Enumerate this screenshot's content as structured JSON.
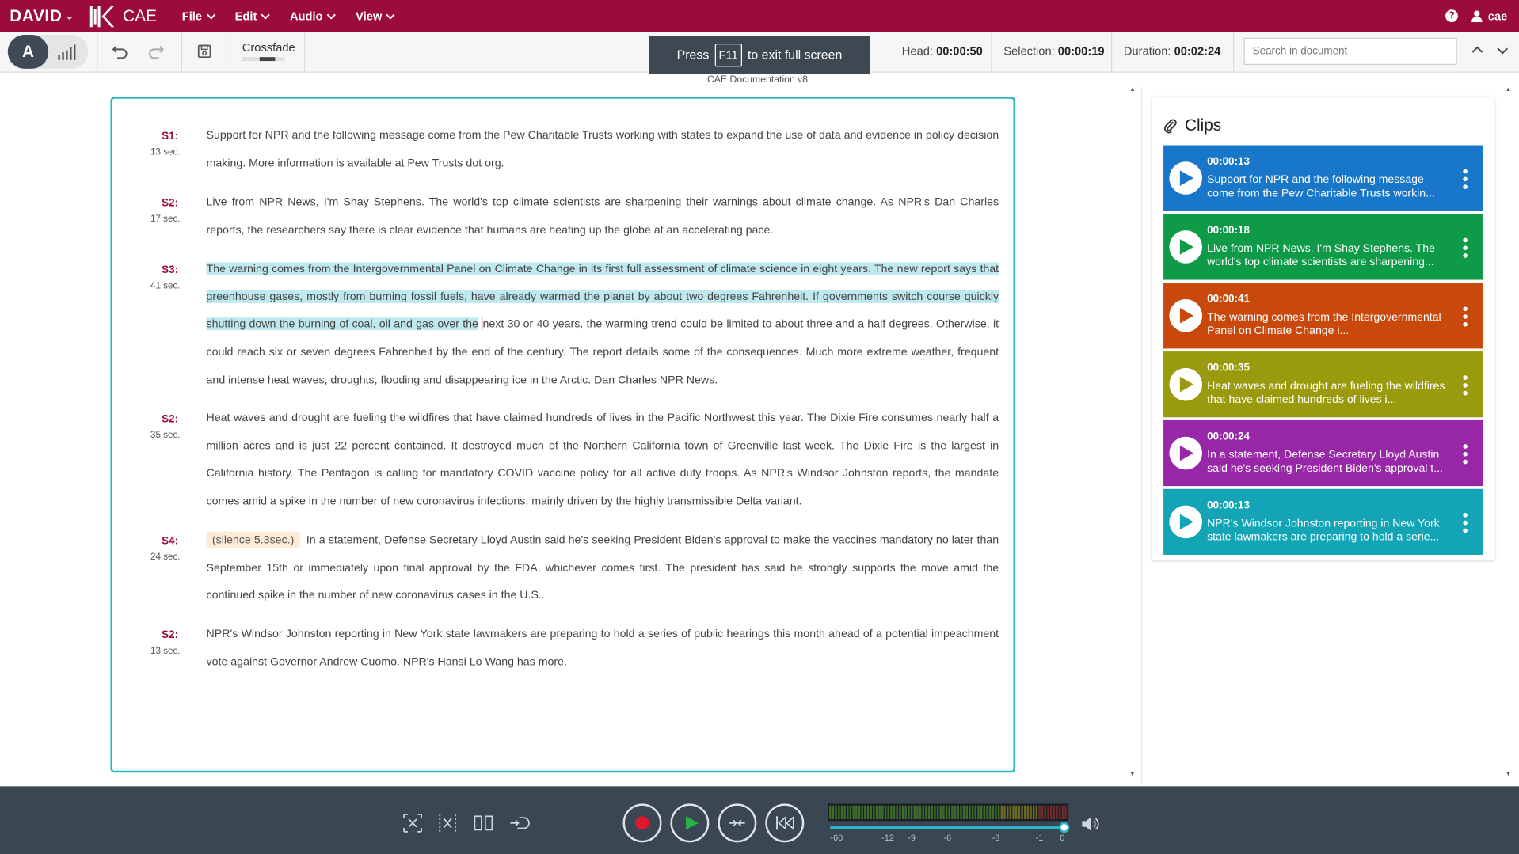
{
  "app": {
    "brand": "DAVID",
    "name": "CAE"
  },
  "menu": [
    {
      "label": "File"
    },
    {
      "label": "Edit"
    },
    {
      "label": "Audio"
    },
    {
      "label": "View"
    }
  ],
  "user": {
    "name": "cae"
  },
  "toolbar": {
    "mode_text_label": "A",
    "crossfade_label": "Crossfade",
    "fullscreen_press": "Press",
    "fullscreen_key": "F11",
    "fullscreen_msg": "to exit full screen",
    "doc_title": "CAE Documentation v8",
    "head_label": "Head:",
    "head_value": "00:00:50",
    "selection_label": "Selection:",
    "selection_value": "00:00:19",
    "duration_label": "Duration:",
    "duration_value": "00:02:24",
    "search_placeholder": "Search in document"
  },
  "segments": [
    {
      "speaker": "S1:",
      "duration": "13 sec.",
      "text": "Support for NPR and the following message come from the Pew Charitable Trusts working with states to expand the use of data and evidence in policy decision making. More information is available at Pew Trusts dot org."
    },
    {
      "speaker": "S2:",
      "duration": "17 sec.",
      "text": "Live from NPR News, I'm Shay Stephens. The world's top climate scientists are sharpening their warnings about climate change. As NPR's Dan Charles reports, the researchers say there is clear evidence that humans are heating up the globe at an accelerating pace."
    },
    {
      "speaker": "S3:",
      "duration": "41 sec.",
      "text_highlighted": "The warning comes from the Intergovernmental Panel on Climate Change in its first full assessment of climate science in eight years. The new report says that greenhouse gases, mostly from burning fossil fuels, have already warmed the planet by about two degrees Fahrenheit. If governments switch course quickly shutting down the burning of coal, oil and gas over the",
      "text_rest": "next 30 or 40 years, the warming trend could be limited to about three and a half degrees. Otherwise, it could reach six or seven degrees Fahrenheit by the end of the century. The report details some of the consequences. Much more extreme weather, frequent and intense heat waves, droughts, flooding and disappearing ice in the Arctic. Dan Charles NPR News."
    },
    {
      "speaker": "S2:",
      "duration": "35 sec.",
      "text": "Heat waves and drought are fueling the wildfires that have claimed hundreds of lives in the Pacific Northwest this year. The Dixie Fire consumes nearly half a million acres and is just 22 percent contained. It destroyed much of the Northern California town of Greenville last week. The Dixie Fire is the largest in California history. The Pentagon is calling for mandatory COVID vaccine policy for all active duty troops. As NPR's Windsor Johnston reports, the mandate comes amid a spike in the number of new coronavirus infections, mainly driven by the highly transmissible Delta variant."
    },
    {
      "speaker": "S4:",
      "duration": "24 sec.",
      "silence": "(silence 5.3sec.)",
      "text": "In a statement, Defense Secretary Lloyd Austin said he's seeking President Biden's approval to make the vaccines mandatory no later than September 15th or immediately upon final approval by the FDA, whichever comes first. The president has said he strongly supports the move amid the continued spike in the number of new coronavirus cases in the U.S.."
    },
    {
      "speaker": "S2:",
      "duration": "13 sec.",
      "text": "NPR's Windsor Johnston reporting in New York state lawmakers are preparing to hold a series of public hearings this month ahead of a potential impeachment vote against Governor Andrew Cuomo. NPR's Hansi Lo Wang has more."
    }
  ],
  "clips_panel": {
    "title": "Clips",
    "clips": [
      {
        "time": "00:00:13",
        "text": "Support for NPR and the following message come from the Pew Charitable Trusts workin...",
        "color": "#1877c9"
      },
      {
        "time": "00:00:18",
        "text": "Live from NPR News, I'm Shay Stephens. The world's top climate scientists are sharpening...",
        "color": "#0e9a46"
      },
      {
        "time": "00:00:41",
        "text": "The warning comes from the Intergovernmental Panel on Climate Change i...",
        "color": "#c9480b"
      },
      {
        "time": "00:00:35",
        "text": "Heat waves and drought are fueling the wildfires that have claimed hundreds of lives i...",
        "color": "#9a9a0e"
      },
      {
        "time": "00:00:24",
        "text": "In a statement, Defense Secretary Lloyd Austin said he's seeking President Biden's approval t...",
        "color": "#9727a6"
      },
      {
        "time": "00:00:13",
        "text": "NPR's Windsor Johnston reporting in New York state lawmakers are preparing to hold a serie...",
        "color": "#13a5b5"
      }
    ]
  },
  "meter_scale": [
    "-60",
    "-12",
    "-9",
    "-6",
    "-3",
    "-1",
    "0"
  ],
  "colors": {
    "brand": "#9b0c3d",
    "accent": "#2bb6c6",
    "bottom_bar": "#3a4652"
  }
}
